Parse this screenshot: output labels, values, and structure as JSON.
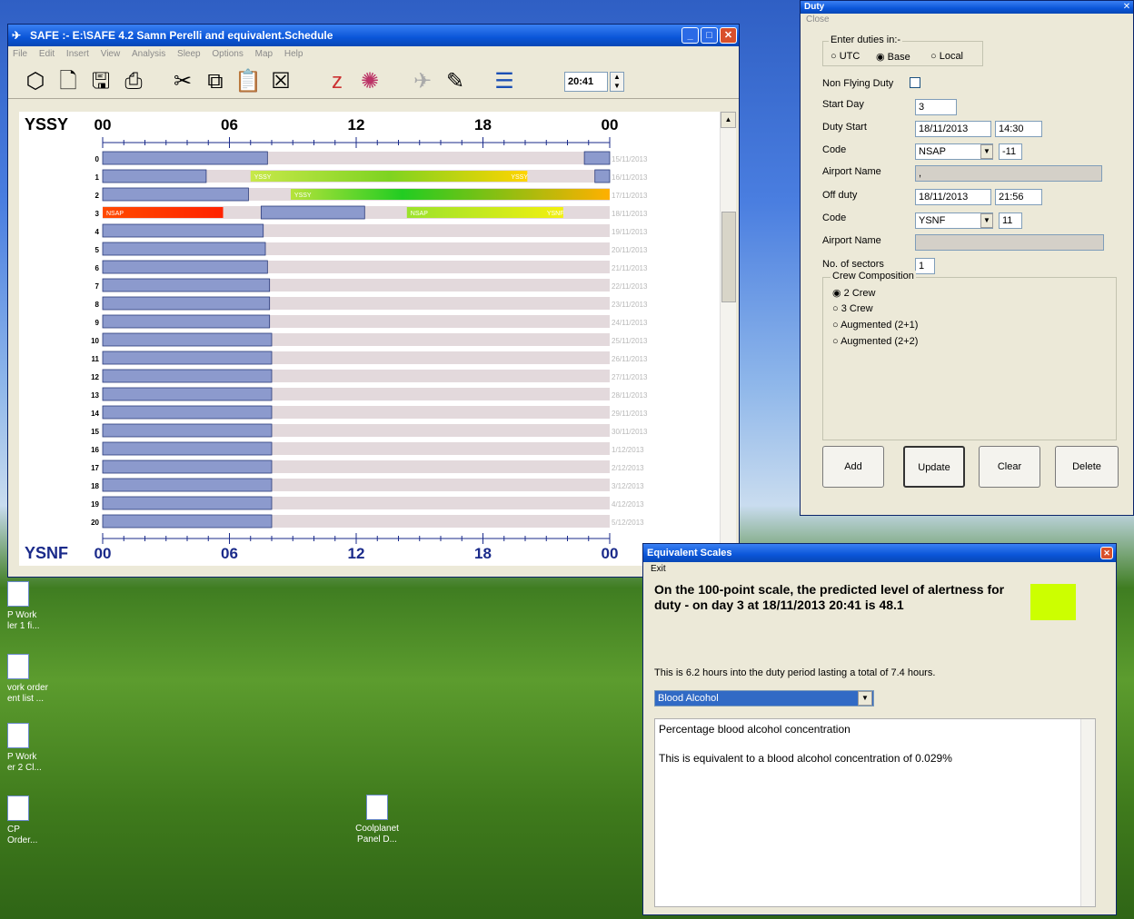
{
  "main": {
    "title": "SAFE :- E:\\SAFE 4.2 Samn Perelli and equivalent.Schedule",
    "menu": [
      "File",
      "Edit",
      "Insert",
      "View",
      "Analysis",
      "Sleep",
      "Options",
      "Map",
      "Help"
    ],
    "time_value": "20:41",
    "top_station": "YSSY",
    "bottom_station": "YSNF",
    "hour_labels": [
      "00",
      "06",
      "12",
      "18",
      "00"
    ],
    "rows": [
      {
        "day": "0",
        "date": "15/11/2013"
      },
      {
        "day": "1",
        "date": "16/11/2013"
      },
      {
        "day": "2",
        "date": "17/11/2013"
      },
      {
        "day": "3",
        "date": "18/11/2013"
      },
      {
        "day": "4",
        "date": "19/11/2013"
      },
      {
        "day": "5",
        "date": "20/11/2013"
      },
      {
        "day": "6",
        "date": "21/11/2013"
      },
      {
        "day": "7",
        "date": "22/11/2013"
      },
      {
        "day": "8",
        "date": "23/11/2013"
      },
      {
        "day": "9",
        "date": "24/11/2013"
      },
      {
        "day": "10",
        "date": "25/11/2013"
      },
      {
        "day": "11",
        "date": "26/11/2013"
      },
      {
        "day": "12",
        "date": "27/11/2013"
      },
      {
        "day": "13",
        "date": "28/11/2013"
      },
      {
        "day": "14",
        "date": "29/11/2013"
      },
      {
        "day": "15",
        "date": "30/11/2013"
      },
      {
        "day": "16",
        "date": "1/12/2013"
      },
      {
        "day": "17",
        "date": "2/12/2013"
      },
      {
        "day": "18",
        "date": "3/12/2013"
      },
      {
        "day": "19",
        "date": "4/12/2013"
      },
      {
        "day": "20",
        "date": "5/12/2013"
      }
    ],
    "duty_labels": {
      "r1a": "YSSY",
      "r1b": "YSSY",
      "r2": "YSSY",
      "r3a": "NSAP",
      "r3b": "NSAP",
      "r3c": "YSNF"
    }
  },
  "duty": {
    "title": "Duty",
    "menu_close": "Close",
    "enter_duties": "Enter duties in:-",
    "utc": "UTC",
    "base": "Base",
    "local": "Local",
    "non_flying": "Non Flying Duty",
    "start_day_label": "Start Day",
    "start_day": "3",
    "duty_start_label": "Duty Start",
    "duty_start_date": "18/11/2013",
    "duty_start_time": "14:30",
    "code_label": "Code",
    "code1": "NSAP",
    "code1_offset": "-11",
    "airport_label": "Airport Name",
    "airport1": ",",
    "off_duty_label": "Off duty",
    "off_date": "18/11/2013",
    "off_time": "21:56",
    "code2": "YSNF",
    "code2_offset": "11",
    "airport2": "",
    "sectors_label": "No. of sectors",
    "sectors": "1",
    "crew_label": "Crew Composition",
    "crew": [
      "2 Crew",
      "3 Crew",
      "Augmented (2+1)",
      "Augmented (2+2)"
    ],
    "buttons": {
      "add": "Add",
      "update": "Update",
      "clear": "Clear",
      "delete": "Delete"
    }
  },
  "eq": {
    "title": "Equivalent Scales",
    "menu_exit": "Exit",
    "headline": "On the 100-point scale, the predicted level of alertness for duty  -  on day 3 at 18/11/2013 20:41 is 48.1",
    "info": "This is 6.2 hours into the duty period lasting a total of 7.4 hours.",
    "select": "Blood Alcohol",
    "text1": "Percentage blood alcohol concentration",
    "text2": "This is equivalent to a blood alcohol concentration of 0.029%",
    "swatch_color": "#ccff00"
  },
  "desktop": {
    "icons": [
      "P Work\nler 1 fi...",
      "vork order\nent list ...",
      "P Work\ner 2 Cl...",
      "CP\nOrder..."
    ],
    "coolplanet": "Coolplanet\nPanel D..."
  }
}
